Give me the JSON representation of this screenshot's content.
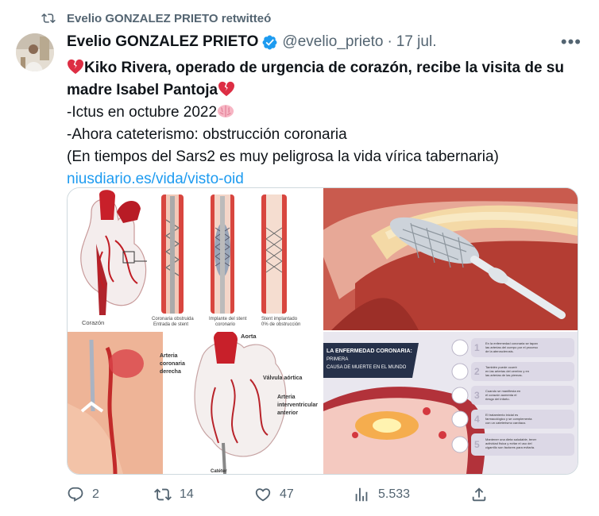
{
  "retweet": {
    "icon": "retweet-icon",
    "text": "Evelio GONZALEZ PRIETO retwitteó"
  },
  "tweet": {
    "author_name": "Evelio GONZALEZ PRIETO",
    "handle": "@evelio_prieto",
    "date": "17 jul.",
    "verified_icon": "verified-badge-icon",
    "title_line": "Kiko Rivera, operado de urgencia de corazón, recibe la visita de su madre Isabel Pantoja",
    "lines": [
      "-Ictus en octubre 2022",
      "-Ahora cateterismo: obstrucción coronaria",
      "(En tiempos del Sars2 es muy peligrosa la vida vírica tabernaria)"
    ],
    "link": "niusdiario.es/vida/visto-oid"
  },
  "media": {
    "tile1": {
      "captions": [
        "Corazón",
        "Coronaria obstruida Entrada de stent",
        "Implante del stent coronario",
        "Stent implantado 0% de obstrucción"
      ]
    },
    "tile3": {
      "labels": [
        "Aorta",
        "Arteria coronaria derecha",
        "Válvula aórtica",
        "Arteria interventricular anterior",
        "Catéter"
      ]
    },
    "tile4": {
      "title": "LA ENFERMEDAD CORONARIA:",
      "subtitle": "PRIMERA CAUSA DE MUERTE EN EL MUNDO",
      "steps": [
        {
          "num": "1",
          "text": "En la enfermedad coronaria se tapan las arterias del cuerpo por el proceso de la aterosclerosis."
        },
        {
          "num": "2",
          "text": "También puede ocurrir en las arterias del cerebro y en las arterias de las piernas."
        },
        {
          "num": "3",
          "text": "Cuando se manifiesta en el corazón aumenta el riesgo del infarto."
        },
        {
          "num": "4",
          "text": "El tratamiento inicial es farmacológico y se complementa con un cateterismo cardíaco."
        },
        {
          "num": "5",
          "text": "Mantener una dieta saludable, tener actividad física y evitar el uso del cigarrillo son factores para evitarla."
        }
      ]
    }
  },
  "actions": {
    "replies": "2",
    "retweets": "14",
    "likes": "47",
    "views": "5.533"
  }
}
